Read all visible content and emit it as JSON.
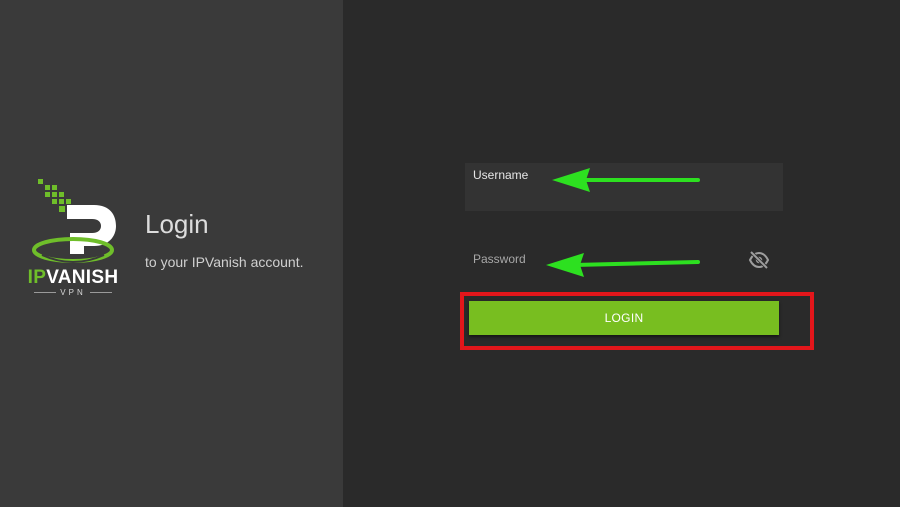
{
  "branding": {
    "logo_word_ip": "IP",
    "logo_word_vanish": "VANISH",
    "logo_sub": "VPN",
    "accent_color": "#78be20"
  },
  "header": {
    "title": "Login",
    "subtitle": "to your IPVanish account."
  },
  "form": {
    "username_label": "Username",
    "password_label": "Password",
    "password_toggle_icon": "eye-off-icon",
    "login_label": "LOGIN"
  },
  "annotations": {
    "arrow_color": "#2de020",
    "highlight_color": "#e3161b"
  }
}
